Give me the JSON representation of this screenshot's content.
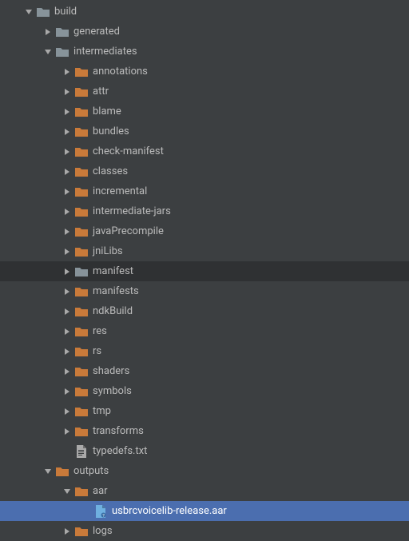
{
  "colors": {
    "folder_orange": "#c97a3a",
    "folder_grey": "#87939a",
    "arrow": "#a9a9a9",
    "file_icon": "#a9a9a9",
    "aar_icon": "#6fb0e0"
  },
  "tree": [
    {
      "depth": 1,
      "expanded": true,
      "icon": "folder-grey",
      "label": "build"
    },
    {
      "depth": 2,
      "expanded": false,
      "icon": "folder-grey",
      "label": "generated"
    },
    {
      "depth": 2,
      "expanded": true,
      "icon": "folder-grey",
      "label": "intermediates"
    },
    {
      "depth": 3,
      "expanded": false,
      "icon": "folder-orange",
      "label": "annotations"
    },
    {
      "depth": 3,
      "expanded": false,
      "icon": "folder-orange",
      "label": "attr"
    },
    {
      "depth": 3,
      "expanded": false,
      "icon": "folder-orange",
      "label": "blame"
    },
    {
      "depth": 3,
      "expanded": false,
      "icon": "folder-orange",
      "label": "bundles"
    },
    {
      "depth": 3,
      "expanded": false,
      "icon": "folder-orange",
      "label": "check-manifest"
    },
    {
      "depth": 3,
      "expanded": false,
      "icon": "folder-orange",
      "label": "classes"
    },
    {
      "depth": 3,
      "expanded": false,
      "icon": "folder-orange",
      "label": "incremental"
    },
    {
      "depth": 3,
      "expanded": false,
      "icon": "folder-orange",
      "label": "intermediate-jars"
    },
    {
      "depth": 3,
      "expanded": false,
      "icon": "folder-orange",
      "label": "javaPrecompile"
    },
    {
      "depth": 3,
      "expanded": false,
      "icon": "folder-orange",
      "label": "jniLibs"
    },
    {
      "depth": 3,
      "expanded": false,
      "icon": "folder-grey",
      "label": "manifest",
      "hover": true
    },
    {
      "depth": 3,
      "expanded": false,
      "icon": "folder-orange",
      "label": "manifests"
    },
    {
      "depth": 3,
      "expanded": false,
      "icon": "folder-orange",
      "label": "ndkBuild"
    },
    {
      "depth": 3,
      "expanded": false,
      "icon": "folder-orange",
      "label": "res"
    },
    {
      "depth": 3,
      "expanded": false,
      "icon": "folder-orange",
      "label": "rs"
    },
    {
      "depth": 3,
      "expanded": false,
      "icon": "folder-orange",
      "label": "shaders"
    },
    {
      "depth": 3,
      "expanded": false,
      "icon": "folder-orange",
      "label": "symbols"
    },
    {
      "depth": 3,
      "expanded": false,
      "icon": "folder-orange",
      "label": "tmp"
    },
    {
      "depth": 3,
      "expanded": false,
      "icon": "folder-orange",
      "label": "transforms"
    },
    {
      "depth": 3,
      "expanded": null,
      "icon": "text-file",
      "label": "typedefs.txt"
    },
    {
      "depth": 2,
      "expanded": true,
      "icon": "folder-orange",
      "label": "outputs"
    },
    {
      "depth": 3,
      "expanded": true,
      "icon": "folder-orange",
      "label": "aar"
    },
    {
      "depth": 4,
      "expanded": null,
      "icon": "aar-file",
      "label": "usbrcvoicelib-release.aar",
      "selected": true
    },
    {
      "depth": 3,
      "expanded": false,
      "icon": "folder-orange",
      "label": "logs"
    }
  ]
}
